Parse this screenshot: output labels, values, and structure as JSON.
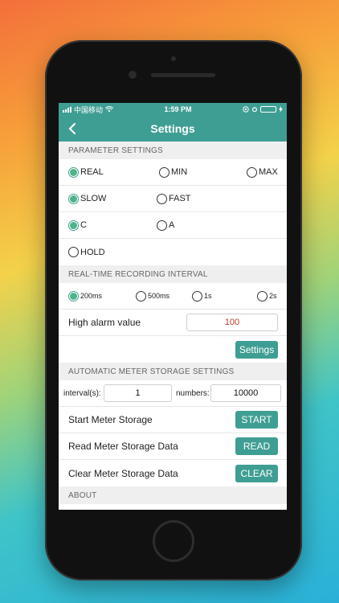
{
  "status": {
    "carrier": "中国移动",
    "time": "1:59 PM"
  },
  "nav": {
    "title": "Settings"
  },
  "parameter": {
    "header": "PARAMETER SETTINGS",
    "row1": [
      "REAL",
      "MIN",
      "MAX"
    ],
    "row2": [
      "SLOW",
      "FAST"
    ],
    "row3": [
      "C",
      "A"
    ],
    "row4": [
      "HOLD"
    ],
    "selected": [
      "REAL",
      "SLOW",
      "C"
    ]
  },
  "recording": {
    "header": "REAL-TIME RECORDING INTERVAL",
    "intervals": [
      "200ms",
      "500ms",
      "1s",
      "2s"
    ],
    "selected": "200ms",
    "high_alarm_label": "High alarm value",
    "high_alarm_value": "100",
    "settings_button": "Settings"
  },
  "storage": {
    "header": "AUTOMATIC METER STORAGE SETTINGS",
    "interval_label": "interval(s):",
    "interval_value": "1",
    "numbers_label": "numbers:",
    "numbers_value": "10000",
    "start_label": "Start Meter Storage",
    "start_button": "START",
    "read_label": "Read Meter Storage Data",
    "read_button": "READ",
    "clear_label": "Clear Meter Storage Data",
    "clear_button": "CLEAR"
  },
  "about": {
    "header": "ABOUT"
  },
  "colors": {
    "accent": "#3f9e93",
    "alarm_value": "#c0392b"
  }
}
